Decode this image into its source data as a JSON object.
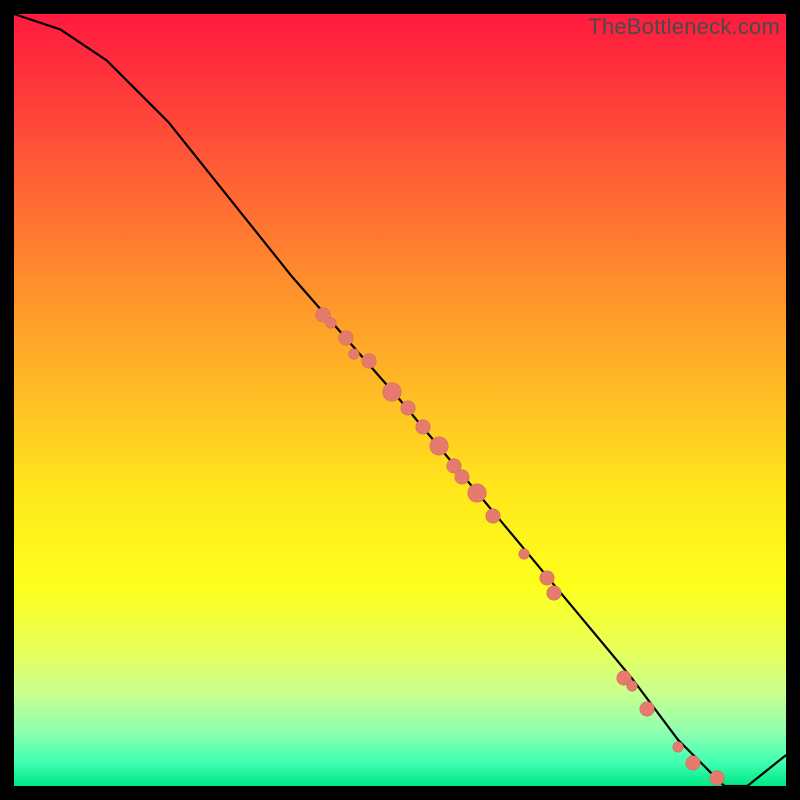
{
  "watermark": "TheBottleneck.com",
  "accent_dot_color": "#e67a6d",
  "chart_data": {
    "type": "line",
    "title": "",
    "xlabel": "",
    "ylabel": "",
    "xlim": [
      0,
      100
    ],
    "ylim": [
      0,
      100
    ],
    "grid": false,
    "legend": false,
    "series": [
      {
        "name": "curve",
        "x": [
          0,
          6,
          12,
          20,
          36,
          50,
          60,
          70,
          80,
          86,
          90,
          92,
          95,
          100
        ],
        "y": [
          100,
          98,
          94,
          86,
          66,
          50,
          38,
          26,
          14,
          6,
          2,
          0,
          0,
          4
        ]
      },
      {
        "name": "markers",
        "points": [
          {
            "x": 40,
            "y": 61,
            "size": "med"
          },
          {
            "x": 41,
            "y": 60,
            "size": "sm"
          },
          {
            "x": 43,
            "y": 58,
            "size": "med"
          },
          {
            "x": 44,
            "y": 56,
            "size": "sm"
          },
          {
            "x": 46,
            "y": 55,
            "size": "med"
          },
          {
            "x": 49,
            "y": 51,
            "size": "lg"
          },
          {
            "x": 51,
            "y": 49,
            "size": "med"
          },
          {
            "x": 53,
            "y": 46.5,
            "size": "med"
          },
          {
            "x": 55,
            "y": 44,
            "size": "lg"
          },
          {
            "x": 57,
            "y": 41.5,
            "size": "med"
          },
          {
            "x": 58,
            "y": 40,
            "size": "med"
          },
          {
            "x": 60,
            "y": 38,
            "size": "lg"
          },
          {
            "x": 62,
            "y": 35,
            "size": "med"
          },
          {
            "x": 66,
            "y": 30,
            "size": "sm"
          },
          {
            "x": 69,
            "y": 27,
            "size": "med"
          },
          {
            "x": 70,
            "y": 25,
            "size": "med"
          },
          {
            "x": 79,
            "y": 14,
            "size": "med"
          },
          {
            "x": 80,
            "y": 13,
            "size": "sm"
          },
          {
            "x": 82,
            "y": 10,
            "size": "med"
          },
          {
            "x": 86,
            "y": 5,
            "size": "sm"
          },
          {
            "x": 88,
            "y": 3,
            "size": "med"
          },
          {
            "x": 91,
            "y": 1,
            "size": "med"
          }
        ]
      }
    ]
  }
}
